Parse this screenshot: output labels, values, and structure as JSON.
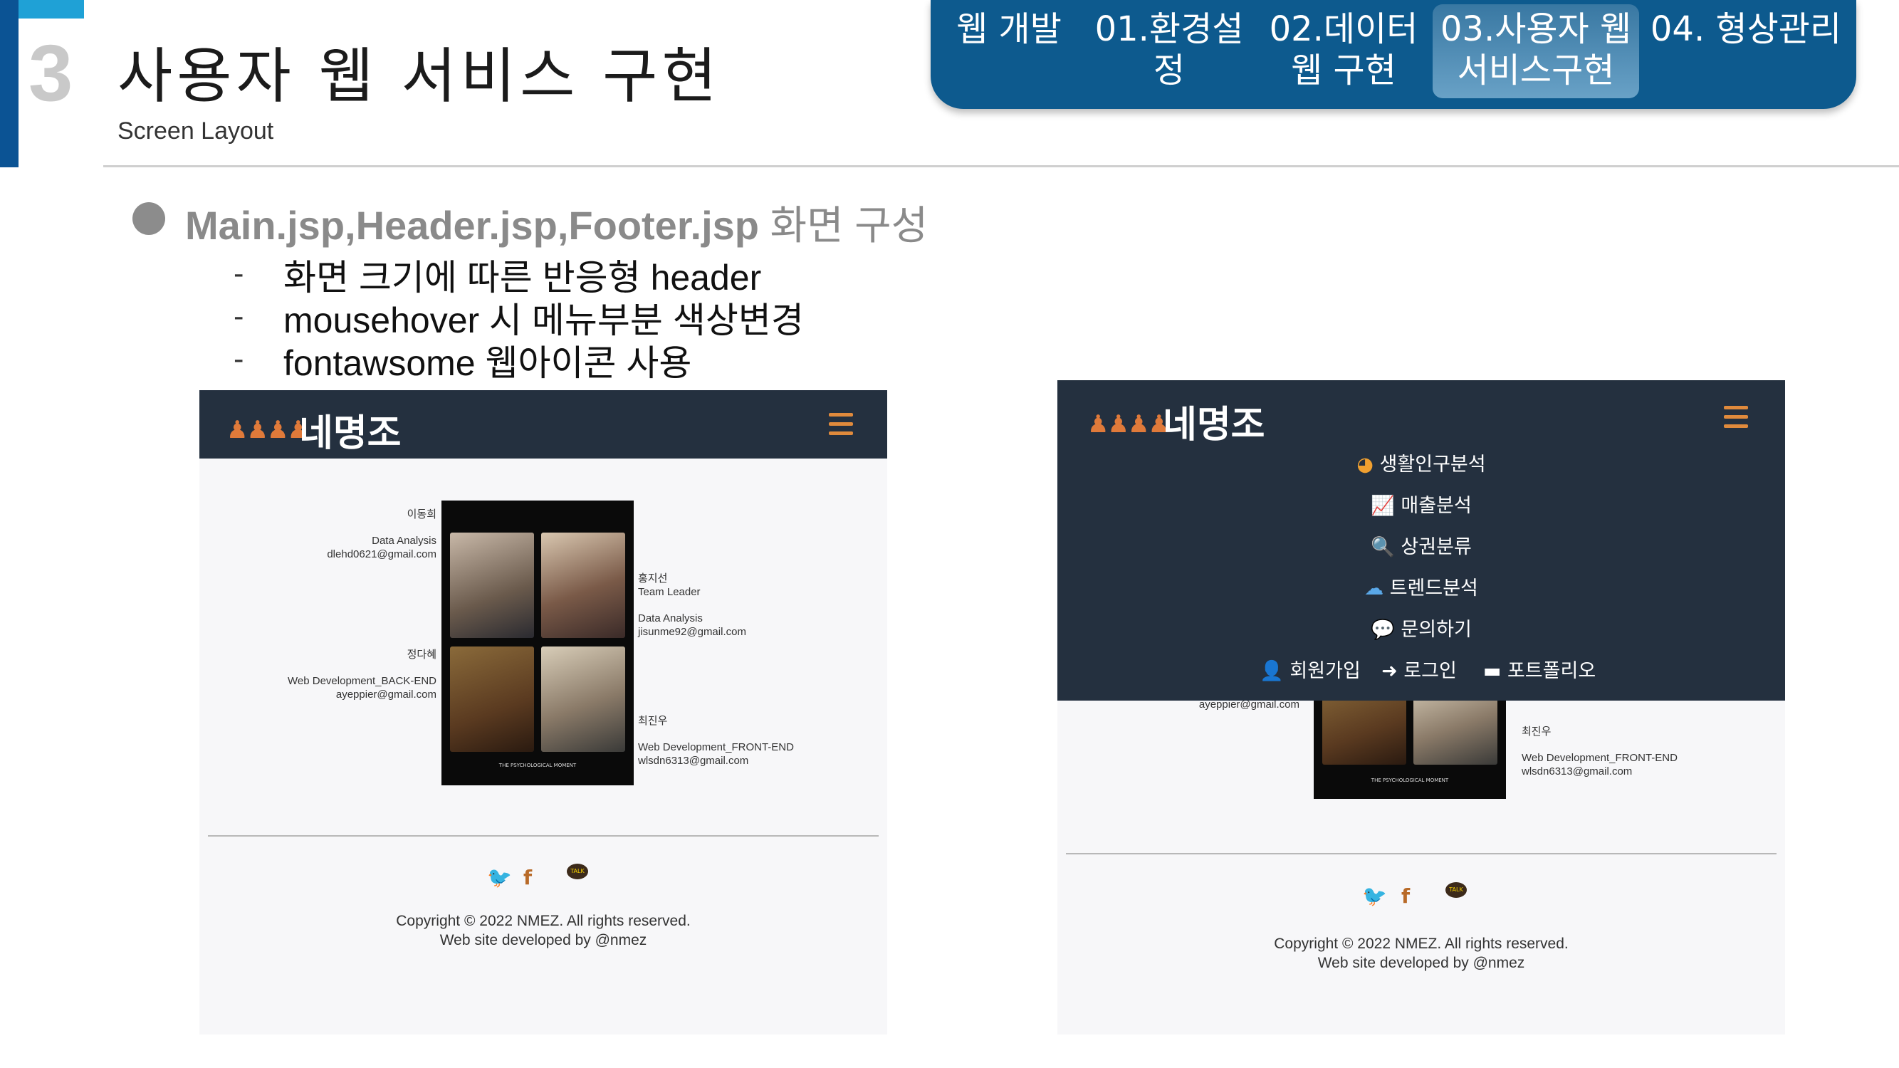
{
  "header": {
    "section_number": "3",
    "title": "사용자 웹 서비스 구현",
    "subtitle": "Screen Layout"
  },
  "nav": {
    "items": [
      {
        "label": "웹 개발"
      },
      {
        "label": "01.환경설정"
      },
      {
        "label": "02.데이터",
        "label2": "웹 구현"
      },
      {
        "label": "03.사용자 웹",
        "label2": "서비스구현",
        "active": true
      },
      {
        "label": "04. 형상관리"
      }
    ]
  },
  "content": {
    "bullet_title_code": "Main.jsp,Header.jsp,Footer.jsp",
    "bullet_title_kr": " 화면 구성",
    "sub_items": [
      {
        "dash": "-",
        "text": "화면 크기에 따른 반응형 header"
      },
      {
        "dash": "-",
        "text": "mousehover 시 메뉴부분 색상변경"
      },
      {
        "dash": "-",
        "text": "fontawsome 웹아이콘 사용"
      }
    ]
  },
  "screenshot_left": {
    "logo_people": "♟♟♟♟",
    "logo_text": "네명조",
    "members": {
      "m1": {
        "name": "이동희",
        "role": "Data Analysis",
        "email": "dlehd0621@gmail.com"
      },
      "m2": {
        "name": "홍지선",
        "role": "Team Leader",
        "role2": "Data Analysis",
        "email": "jisunme92@gmail.com"
      },
      "m3": {
        "name": "정다혜",
        "role": "Web Development_BACK-END",
        "email": "ayeppier@gmail.com"
      },
      "m4": {
        "name": "최진우",
        "role": "Web Development_FRONT-END",
        "email": "wlsdn6313@gmail.com"
      }
    },
    "photo_caption": "THE PSYCHOLOGICAL MOMENT",
    "copyright": "Copyright © 2022 NMEZ. All rights reserved.",
    "developed_by": "Web site developed by @nmez"
  },
  "screenshot_right": {
    "logo_people": "♟♟♟♟",
    "logo_text": "네명조",
    "menu": [
      {
        "icon": "◕",
        "label": "생활인구분석",
        "color": "#f0a030"
      },
      {
        "icon": "📈",
        "label": "매출분석",
        "color": "#b98be0"
      },
      {
        "icon": "🔍",
        "label": "상권분류",
        "color": "#3cc060"
      },
      {
        "icon": "☁",
        "label": "트렌드분석",
        "color": "#5aa8e8"
      },
      {
        "icon": "💬",
        "label": "문의하기",
        "color": "#e86a9a"
      }
    ],
    "auth": [
      {
        "icon": "👤",
        "label": "회원가입"
      },
      {
        "icon": "➜",
        "label": "로그인"
      },
      {
        "icon": "▬",
        "label": "포트폴리오"
      }
    ],
    "visible_email": "ayeppier@gmail.com",
    "member": {
      "name": "최진우",
      "role": "Web Development_FRONT-END",
      "email": "wlsdn6313@gmail.com"
    },
    "photo_caption": "THE PSYCHOLOGICAL MOMENT",
    "copyright": "Copyright © 2022 NMEZ. All rights reserved.",
    "developed_by": "Web site developed by @nmez"
  },
  "social": {
    "twitter": "🐦",
    "facebook": "f",
    "talk": "TALK"
  },
  "colors": {
    "accent_blue": "#0b5394",
    "nav_bg": "#0d5a8e",
    "site_nav": "#24303f",
    "brand_orange": "#e07a3a"
  }
}
